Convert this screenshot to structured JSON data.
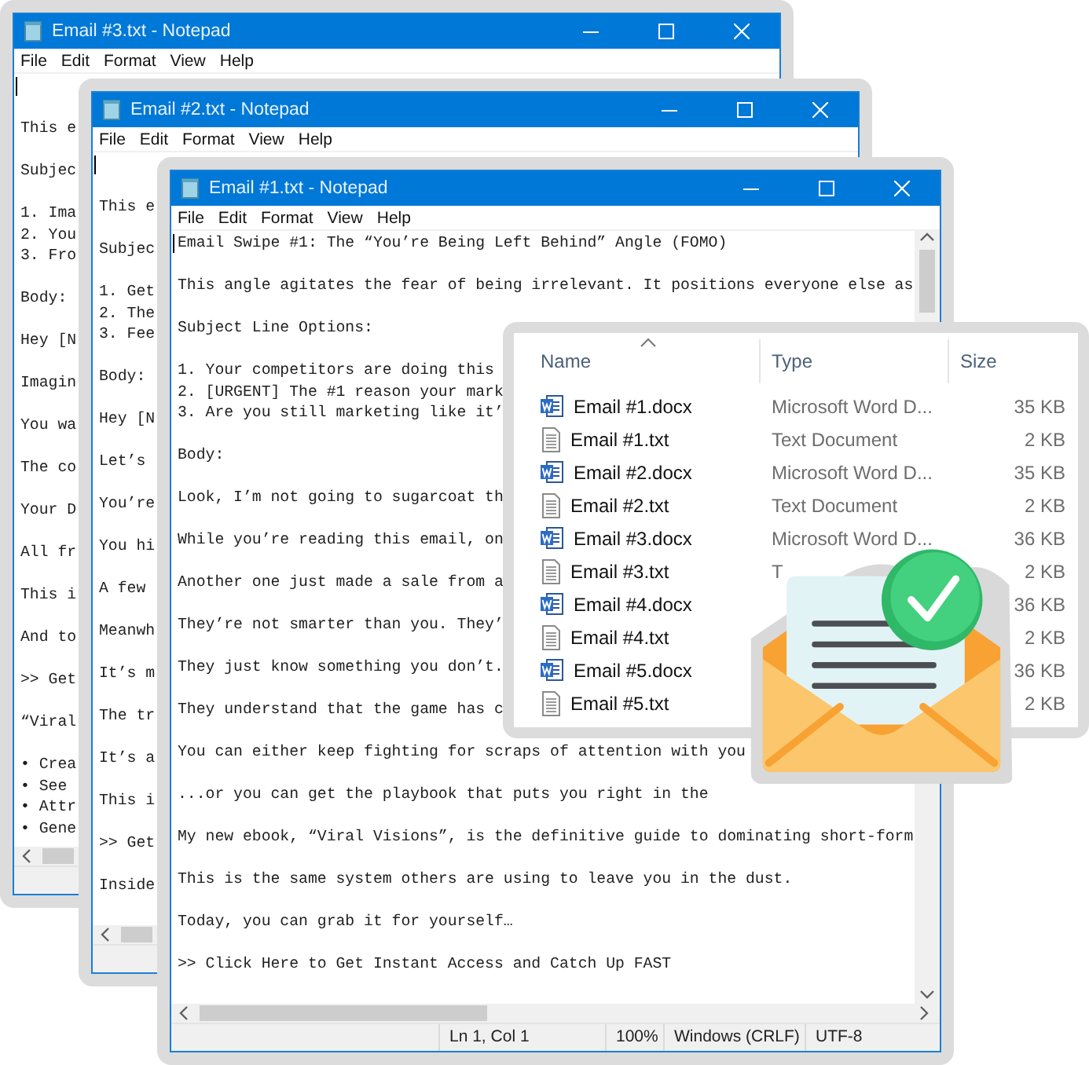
{
  "windows": [
    {
      "title": "Email #3.txt - Notepad",
      "menu": [
        "File",
        "Edit",
        "Format",
        "View",
        "Help"
      ],
      "paragraphs": [
        [
          "This e"
        ],
        [
          "Subjec"
        ],
        [
          "1. Ima",
          "2. You",
          "3. Fro"
        ],
        [
          "Body:"
        ],
        [
          "Hey [N"
        ],
        [
          "Imagin"
        ],
        [
          "You wa"
        ],
        [
          "The co"
        ],
        [
          "Your D"
        ],
        [
          "All fr"
        ],
        [
          "This i"
        ],
        [
          "And to"
        ],
        [
          ">> Get"
        ],
        [
          "“Viral"
        ],
        [
          "• Crea",
          "• See",
          "• Attr",
          "• Gene"
        ]
      ]
    },
    {
      "title": "Email #2.txt - Notepad",
      "menu": [
        "File",
        "Edit",
        "Format",
        "View",
        "Help"
      ],
      "paragraphs": [
        [
          "This e"
        ],
        [
          "Subjec"
        ],
        [
          "1. Get",
          "2. The",
          "3. Fee"
        ],
        [
          "Body:"
        ],
        [
          "Hey [N"
        ],
        [
          "Let’s"
        ],
        [
          "You’re"
        ],
        [
          "You hi"
        ],
        [
          "A few"
        ],
        [
          "Meanwh"
        ],
        [
          "It’s m"
        ],
        [
          "The tr"
        ],
        [
          "It’s a"
        ],
        [
          "This i"
        ],
        [
          ">> Get"
        ],
        [
          "Inside"
        ]
      ]
    },
    {
      "title": "Email #1.txt - Notepad",
      "menu": [
        "File",
        "Edit",
        "Format",
        "View",
        "Help"
      ],
      "paragraphs": [
        [
          "Email Swipe #1: The “You’re Being Left Behind” Angle (FOMO)"
        ],
        [
          "This angle agitates the fear of being irrelevant. It positions everyone else as"
        ],
        [
          "Subject Line Options:"
        ],
        [
          "1. Your competitors are doing this",
          "2. [URGENT] The #1 reason your mark",
          "3. Are you still marketing like it’"
        ],
        [
          "Body:"
        ],
        [
          "Look, I’m not going to sugarcoat th"
        ],
        [
          "While you’re reading this email, on"
        ],
        [
          "Another one just made a sale from a"
        ],
        [
          "They’re not smarter than you. They’"
        ],
        [
          "They just know something you don’t."
        ],
        [
          "They understand that the game has c"
        ],
        [
          "You can either keep fighting for scraps of attention with you"
        ],
        [
          "...or you can get the playbook that puts you right in the"
        ],
        [
          "My new ebook, “Viral Visions”, is the definitive guide to dominating short-form"
        ],
        [
          "This is the same system others are using to leave you in the dust."
        ],
        [
          "Today, you can grab it for yourself…"
        ],
        [
          ">> Click Here to Get Instant Access and Catch Up FAST"
        ]
      ],
      "status": [
        "Ln 1, Col 1",
        "100%",
        "Windows (CRLF)",
        "UTF-8"
      ]
    }
  ],
  "file_list": {
    "columns": [
      "Name",
      "Type",
      "Size"
    ],
    "rows": [
      {
        "kind": "docx",
        "name": "Email #1.docx",
        "type": "Microsoft Word D...",
        "size": "35 KB"
      },
      {
        "kind": "txt",
        "name": "Email #1.txt",
        "type": "Text Document",
        "size": "2 KB"
      },
      {
        "kind": "docx",
        "name": "Email #2.docx",
        "type": "Microsoft Word D...",
        "size": "35 KB"
      },
      {
        "kind": "txt",
        "name": "Email #2.txt",
        "type": "Text Document",
        "size": "2 KB"
      },
      {
        "kind": "docx",
        "name": "Email #3.docx",
        "type": "Microsoft Word D...",
        "size": "36 KB"
      },
      {
        "kind": "txt",
        "name": "Email #3.txt",
        "type": "T",
        "size": "2 KB"
      },
      {
        "kind": "docx",
        "name": "Email #4.docx",
        "size": "36 KB"
      },
      {
        "kind": "txt",
        "name": "Email #4.txt",
        "size": "2 KB"
      },
      {
        "kind": "docx",
        "name": "Email #5.docx",
        "size": "36 KB"
      },
      {
        "kind": "txt",
        "name": "Email #5.txt",
        "size": "2 KB"
      }
    ]
  }
}
